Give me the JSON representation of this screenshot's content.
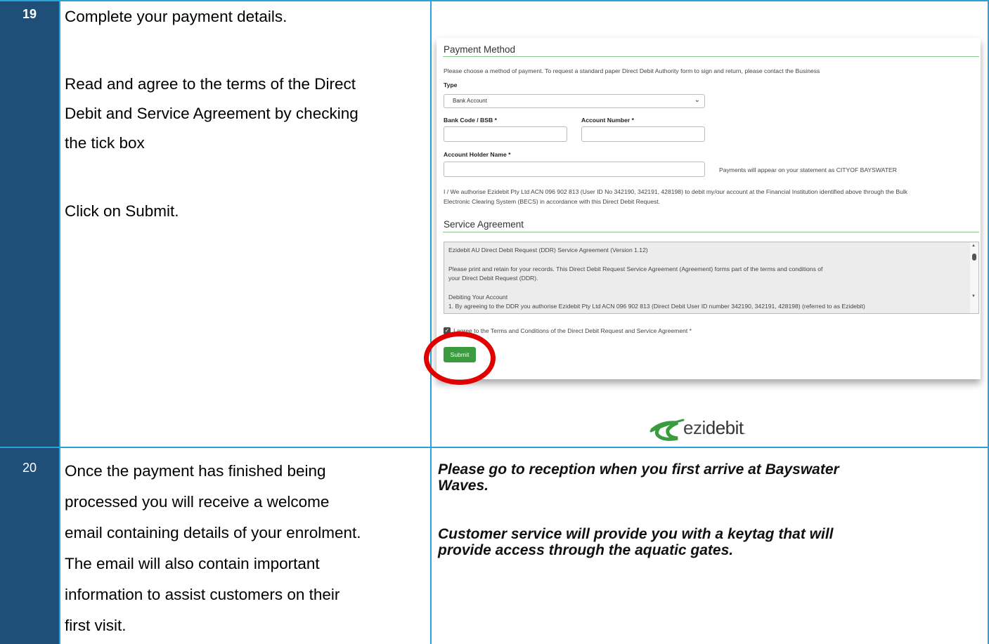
{
  "rows": [
    {
      "number": "19",
      "instructions": [
        "Complete your payment details.",
        "Read and agree to the terms of the Direct",
        "Debit and Service Agreement by checking",
        "the tick box",
        "Click on Submit."
      ]
    },
    {
      "number": "20",
      "instructions": [
        "Once the payment has finished being",
        "processed you will receive a welcome",
        "email containing details of your enrolment.",
        "The email will also contain important",
        "information to assist customers on their",
        "first visit."
      ]
    }
  ],
  "screenshot": {
    "payment_method_title": "Payment Method",
    "payment_intro": "Please choose a method of payment. To request a standard paper Direct Debit Authority form to sign and return, please contact the Business",
    "type_label": "Type",
    "type_value": "Bank Account",
    "bsb_label": "Bank Code / BSB *",
    "account_number_label": "Account Number *",
    "account_holder_label": "Account Holder Name *",
    "statement_note": "Payments will appear on your statement as CITYOF BAYSWATER",
    "authorise_line1": "I / We authorise Ezidebit Pty Ltd ACN 096 902 813 (User ID No 342190, 342191, 428198) to debit my/our account at the Financial Institution identified above through the Bulk",
    "authorise_line2": "Electronic Clearing System (BECS) in accordance with this Direct Debit Request.",
    "service_agreement_title": "Service Agreement",
    "agreement_lines": [
      "Ezidebit AU Direct Debit Request (DDR) Service Agreement (Version 1.12)",
      "Please print and retain for your records. This Direct Debit Request Service Agreement (Agreement) forms part of the terms and conditions of",
      "your Direct Debit Request (DDR).",
      "Debiting Your Account",
      "1.  By agreeing to the DDR you authorise Ezidebit Pty Ltd ACN 096 902 813 (Direct Debit User ID number 342190, 342191, 428198) (referred to as Ezidebit)"
    ],
    "agree_label": "I agree to the Terms and Conditions of the Direct Debit Request and Service Agreement *",
    "submit_label": "Submit",
    "logo_text_a": "ezi",
    "logo_text_b": "debit",
    "logo_suffix": "."
  },
  "notes": {
    "line1": "Please go to reception when you first arrive at Bayswater",
    "line2": "Waves.",
    "line3": "Customer service will provide you with a keytag that will",
    "line4": "provide access through the aquatic gates."
  },
  "colors": {
    "number_column": "#1f4e79",
    "grid": "#29a3d6",
    "submit_button": "#3a9b3f",
    "highlight_ring": "#e00000"
  }
}
